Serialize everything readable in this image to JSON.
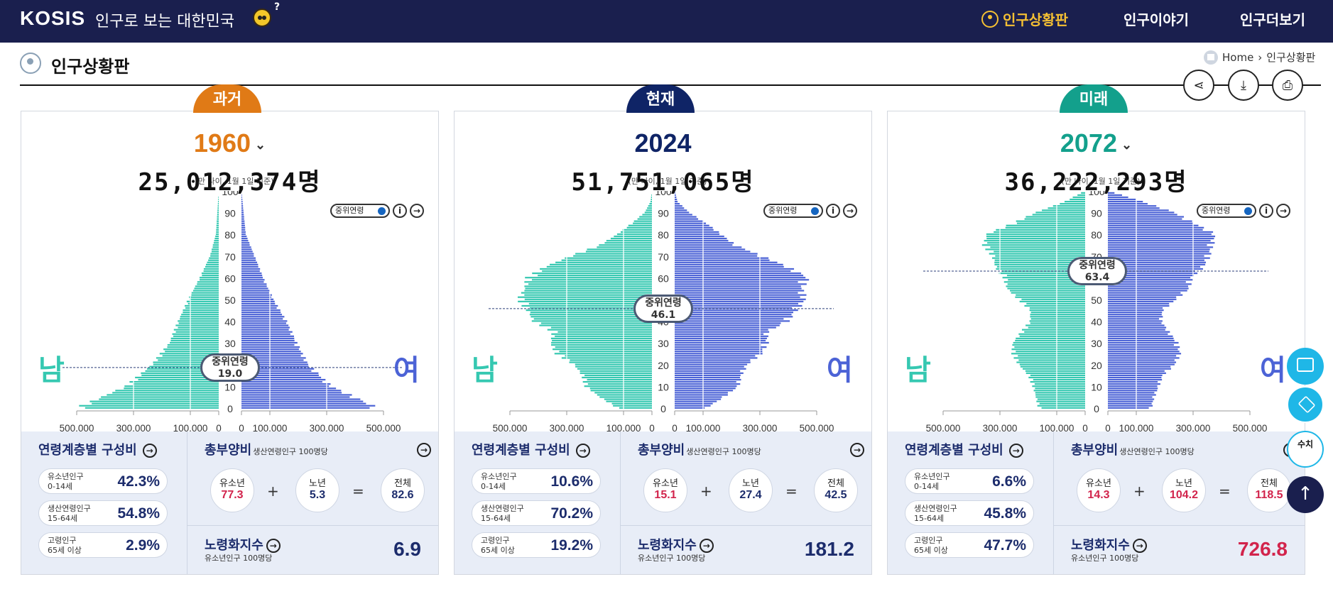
{
  "header": {
    "logo": "KOSIS",
    "slogan": "인구로 보는 대한민국",
    "nav": [
      "인구상황판",
      "인구이야기",
      "인구더보기"
    ]
  },
  "page": {
    "title": "인구상황판",
    "breadcrumb": [
      "Home",
      "인구상황판"
    ]
  },
  "colors": {
    "male": "#35c8b1",
    "female": "#4c63d6",
    "past": "#e07a16",
    "present": "#0f2466",
    "future": "#13a08c"
  },
  "icons": [
    "share-icon",
    "download-icon",
    "print-icon",
    "chevron-down-icon",
    "info-icon",
    "arrow-right-icon",
    "presentation-icon",
    "layers-icon",
    "arrow-up-icon"
  ],
  "panels": [
    {
      "tag": "과거",
      "year": "1960",
      "population": "25,012,374명",
      "note": "(만 나이, 1월 1일 기준)",
      "toggle": "중위연령",
      "median_label": "중위연령",
      "median_value": "19.0",
      "male": "남",
      "female": "여",
      "age_title": "연령계층별 구성비",
      "groups": [
        {
          "name": "유소년인구",
          "range": "0-14세",
          "value": "42.3%"
        },
        {
          "name": "생산연령인구",
          "range": "15-64세",
          "value": "54.8%"
        },
        {
          "name": "고령인구",
          "range": "65세 이상",
          "value": "2.9%"
        }
      ],
      "dep_title": "총부양비",
      "dep_sub": "생산연령인구 100명당",
      "youth_label": "유소년",
      "youth": "77.3",
      "elder_label": "노년",
      "elder": "5.3",
      "total_label": "전체",
      "total": "82.6",
      "aging_title": "노령화지수",
      "aging_sub": "유소년인구 100명당",
      "aging": "6.9"
    },
    {
      "tag": "현재",
      "year": "2024",
      "population": "51,751,065명",
      "note": "(만 나이, 1월 1일 기준)",
      "toggle": "중위연령",
      "median_label": "중위연령",
      "median_value": "46.1",
      "male": "남",
      "female": "여",
      "age_title": "연령계층별 구성비",
      "groups": [
        {
          "name": "유소년인구",
          "range": "0-14세",
          "value": "10.6%"
        },
        {
          "name": "생산연령인구",
          "range": "15-64세",
          "value": "70.2%"
        },
        {
          "name": "고령인구",
          "range": "65세 이상",
          "value": "19.2%"
        }
      ],
      "dep_title": "총부양비",
      "dep_sub": "생산연령인구 100명당",
      "youth_label": "유소년",
      "youth": "15.1",
      "elder_label": "노년",
      "elder": "27.4",
      "total_label": "전체",
      "total": "42.5",
      "aging_title": "노령화지수",
      "aging_sub": "유소년인구 100명당",
      "aging": "181.2"
    },
    {
      "tag": "미래",
      "year": "2072",
      "population": "36,222,293명",
      "note": "(만 나이, 1월 1일 기준)",
      "toggle": "중위연령",
      "median_label": "중위연령",
      "median_value": "63.4",
      "male": "남",
      "female": "여",
      "age_title": "연령계층별 구성비",
      "groups": [
        {
          "name": "유소년인구",
          "range": "0-14세",
          "value": "6.6%"
        },
        {
          "name": "생산연령인구",
          "range": "15-64세",
          "value": "45.8%"
        },
        {
          "name": "고령인구",
          "range": "65세 이상",
          "value": "47.7%"
        }
      ],
      "dep_title": "총부양비",
      "dep_sub": "생산연령인구 100명당",
      "youth_label": "유소년",
      "youth": "14.3",
      "elder_label": "노년",
      "elder": "104.2",
      "total_label": "전체",
      "total": "118.5",
      "aging_title": "노령화지수",
      "aging_sub": "유소년인구 100명당",
      "aging": "726.8"
    }
  ],
  "chart_data": [
    {
      "type": "bar",
      "orientation": "horizontal-pyramid",
      "year": "1960",
      "median_age": 19.0,
      "y_ticks": [
        "0",
        "10",
        "20",
        "30",
        "40",
        "50",
        "60",
        "70",
        "80",
        "90",
        "100"
      ],
      "x_ticks": [
        "500,000",
        "300,000",
        "100,000",
        "0",
        "0",
        "100,000",
        "300,000",
        "500,000"
      ],
      "xlim": [
        -500000,
        500000
      ],
      "ylim": [
        0,
        100
      ],
      "age_points": [
        0,
        10,
        20,
        30,
        40,
        50,
        60,
        70,
        80,
        100
      ],
      "series": [
        {
          "name": "남",
          "values": [
            490000,
            320000,
            230000,
            170000,
            140000,
            105000,
            65000,
            30000,
            10000,
            0
          ]
        },
        {
          "name": "여",
          "values": [
            470000,
            310000,
            230000,
            190000,
            155000,
            110000,
            75000,
            45000,
            15000,
            0
          ]
        }
      ]
    },
    {
      "type": "bar",
      "orientation": "horizontal-pyramid",
      "year": "2024",
      "median_age": 46.1,
      "y_ticks": [
        "0",
        "10",
        "20",
        "30",
        "40",
        "50",
        "60",
        "70",
        "80",
        "90",
        "100"
      ],
      "x_ticks": [
        "500,000",
        "300,000",
        "100,000",
        "0",
        "0",
        "100,000",
        "300,000",
        "500,000"
      ],
      "xlim": [
        -500000,
        500000
      ],
      "ylim": [
        0,
        100
      ],
      "age_points": [
        0,
        5,
        10,
        15,
        20,
        25,
        30,
        35,
        40,
        45,
        50,
        55,
        60,
        65,
        70,
        75,
        80,
        85,
        90,
        95,
        100
      ],
      "series": [
        {
          "name": "남",
          "values": [
            120000,
            180000,
            230000,
            240000,
            270000,
            330000,
            350000,
            340000,
            410000,
            430000,
            460000,
            440000,
            430000,
            370000,
            280000,
            180000,
            120000,
            70000,
            25000,
            5000,
            0
          ]
        },
        {
          "name": "여",
          "values": [
            110000,
            170000,
            220000,
            230000,
            250000,
            300000,
            320000,
            320000,
            390000,
            420000,
            450000,
            440000,
            460000,
            390000,
            300000,
            210000,
            160000,
            110000,
            50000,
            10000,
            0
          ]
        }
      ]
    },
    {
      "type": "bar",
      "orientation": "horizontal-pyramid",
      "year": "2072",
      "median_age": 63.4,
      "y_ticks": [
        "0",
        "10",
        "20",
        "30",
        "40",
        "50",
        "60",
        "70",
        "80",
        "90",
        "100"
      ],
      "x_ticks": [
        "500,000",
        "300,000",
        "100,000",
        "0",
        "0",
        "100,000",
        "300,000",
        "500,000"
      ],
      "xlim": [
        -500000,
        500000
      ],
      "ylim": [
        0,
        100
      ],
      "age_points": [
        0,
        5,
        10,
        15,
        20,
        25,
        30,
        35,
        40,
        45,
        50,
        55,
        60,
        65,
        70,
        75,
        80,
        85,
        90,
        95,
        100
      ],
      "series": [
        {
          "name": "남",
          "values": [
            160000,
            170000,
            180000,
            195000,
            230000,
            250000,
            250000,
            220000,
            190000,
            190000,
            230000,
            270000,
            280000,
            310000,
            320000,
            350000,
            340000,
            250000,
            170000,
            70000,
            0
          ]
        },
        {
          "name": "여",
          "values": [
            150000,
            160000,
            175000,
            190000,
            230000,
            250000,
            240000,
            210000,
            185000,
            190000,
            235000,
            280000,
            290000,
            330000,
            350000,
            360000,
            370000,
            300000,
            230000,
            120000,
            0
          ]
        }
      ]
    }
  ]
}
